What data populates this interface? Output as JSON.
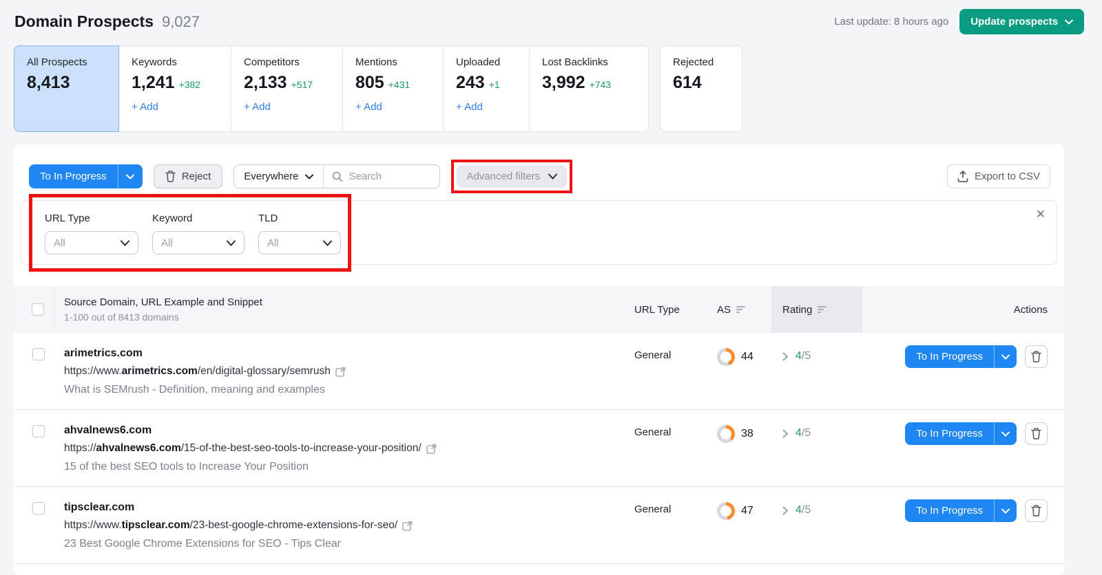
{
  "page": {
    "title": "Domain Prospects",
    "total_count": "9,027",
    "last_update": "Last update: 8 hours ago",
    "update_button": "Update prospects"
  },
  "tabs": [
    {
      "label": "All Prospects",
      "value": "8,413",
      "delta": "",
      "selected": true
    },
    {
      "label": "Keywords",
      "value": "1,241",
      "delta": "+382"
    },
    {
      "label": "Competitors",
      "value": "2,133",
      "delta": "+517"
    },
    {
      "label": "Mentions",
      "value": "805",
      "delta": "+431"
    },
    {
      "label": "Uploaded",
      "value": "243",
      "delta": "+1"
    },
    {
      "label": "Lost Backlinks",
      "value": "3,992",
      "delta": "+743"
    },
    {
      "label": "Rejected",
      "value": "614",
      "delta": ""
    }
  ],
  "toolbar": {
    "bulk_action_label": "To In Progress",
    "reject_label": "Reject",
    "scope_label": "Everywhere",
    "search_placeholder": "Search",
    "advanced_filters_label": "Advanced filters",
    "export_label": "Export to CSV",
    "add_label": "+ Add"
  },
  "filters": {
    "fields": [
      {
        "label": "URL Type",
        "value": "All"
      },
      {
        "label": "Keyword",
        "value": "All"
      },
      {
        "label": "TLD",
        "value": "All"
      }
    ]
  },
  "icons": {
    "close": "✕"
  },
  "table": {
    "header": {
      "source": "Source Domain, URL Example and Snippet",
      "range": "1-100 out of 8413 domains",
      "url_type": "URL Type",
      "as": "AS",
      "rating": "Rating",
      "actions": "Actions"
    },
    "rows": [
      {
        "domain": "arimetrics.com",
        "url_prefix": "https://www.",
        "url_domain": "arimetrics.com",
        "url_path": "/en/digital-glossary/semrush",
        "snippet": "What is SEMrush - Definition, meaning and examples",
        "url_type": "General",
        "as": 44,
        "rating": "4",
        "rating_total": "/5",
        "action": "To In Progress"
      },
      {
        "domain": "ahvalnews6.com",
        "url_prefix": "https://",
        "url_domain": "ahvalnews6.com",
        "url_path": "/15-of-the-best-seo-tools-to-increase-your-position/",
        "snippet": "15 of the best SEO tools to Increase Your Position",
        "url_type": "General",
        "as": 38,
        "rating": "4",
        "rating_total": "/5",
        "action": "To In Progress"
      },
      {
        "domain": "tipsclear.com",
        "url_prefix": "https://www.",
        "url_domain": "tipsclear.com",
        "url_path": "/23-best-google-chrome-extensions-for-seo/",
        "snippet": "23 Best Google Chrome Extensions for SEO - Tips Clear",
        "url_type": "General",
        "as": 47,
        "rating": "4",
        "rating_total": "/5",
        "action": "To In Progress"
      }
    ]
  },
  "colors": {
    "accent_blue": "#1f87f2",
    "teal": "#0a9c82",
    "green": "#1b9a6c",
    "annotation_red": "#f01212",
    "donut_orange": "#ff8a2b",
    "donut_track": "#d5d8df",
    "link_blue": "#2e7cf0"
  }
}
